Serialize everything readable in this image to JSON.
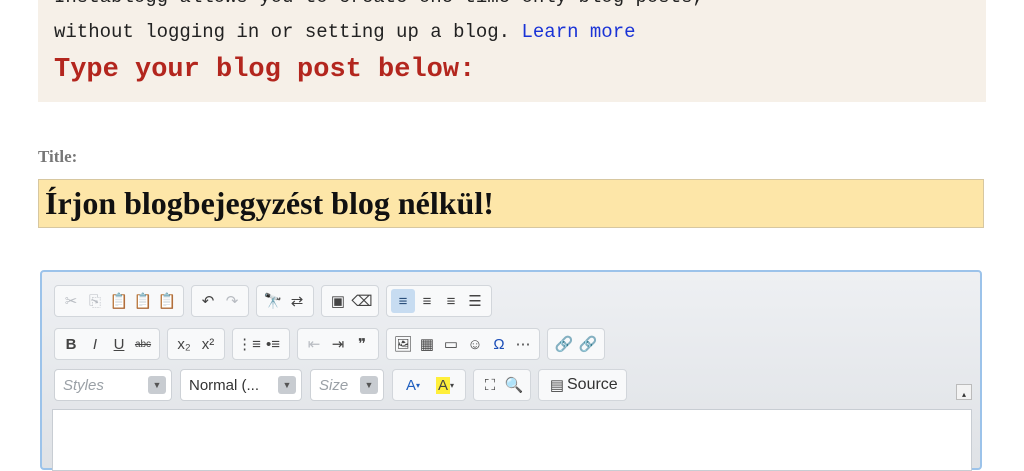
{
  "intro": {
    "line1": "Instablogg allows you to create one-time only blog posts,",
    "line2": "without logging in or setting up a blog.",
    "learn_more": "Learn more",
    "heading": "Type your blog post below:"
  },
  "title_field": {
    "label": "Title:",
    "value": "Írjon blogbejegyzést blog nélkül!"
  },
  "editor": {
    "styles_placeholder": "Styles",
    "format_value": "Normal (...",
    "size_placeholder": "Size",
    "source_label": "Source",
    "colors": {
      "border": "#9cc3ea",
      "active_button": "#c7dcf1"
    }
  }
}
